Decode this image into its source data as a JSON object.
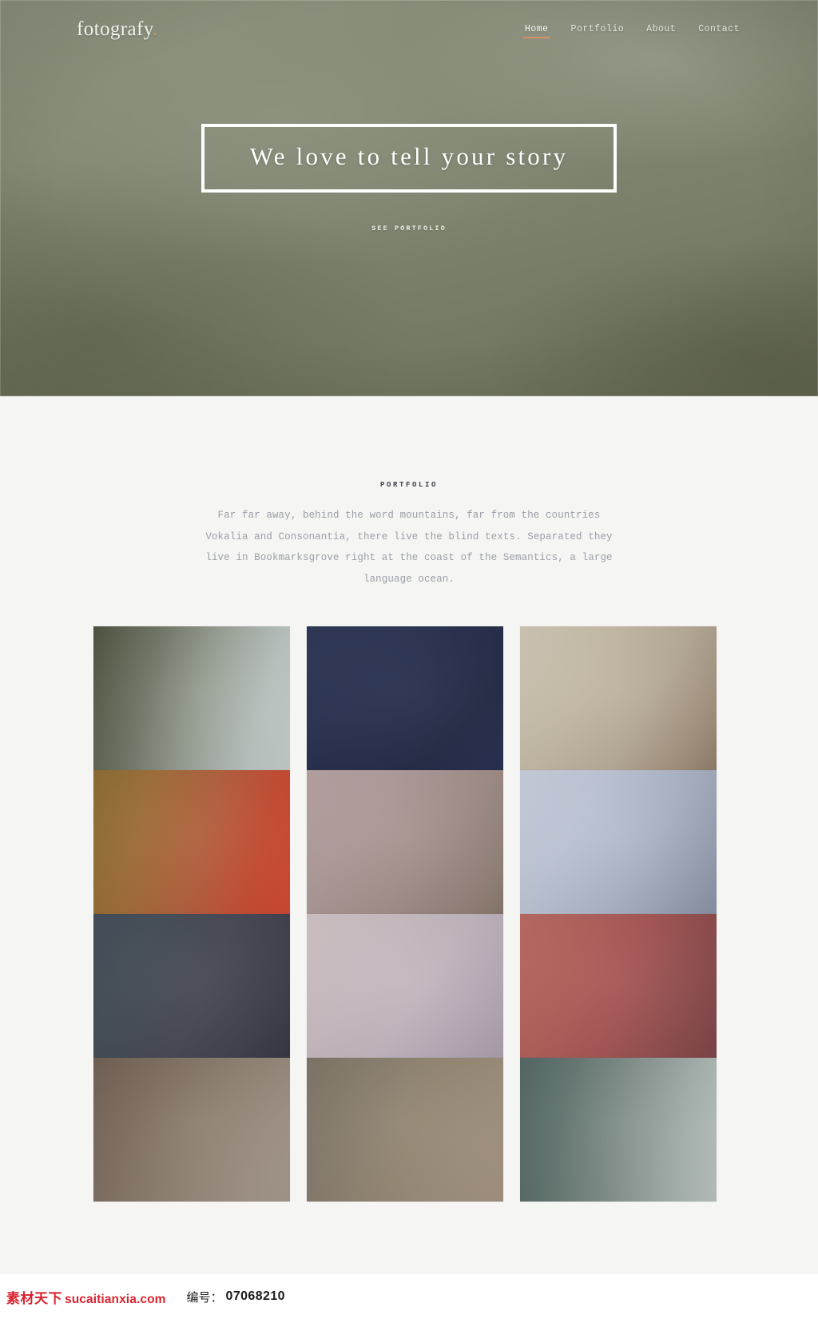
{
  "site": {
    "brand_text": "fotografy",
    "brand_dot": ".",
    "accent_color": "#d98f5f"
  },
  "nav": {
    "items": [
      {
        "label": "Home",
        "active": true
      },
      {
        "label": "Portfolio",
        "active": false
      },
      {
        "label": "About",
        "active": false
      },
      {
        "label": "Contact",
        "active": false
      }
    ]
  },
  "hero": {
    "headline": "We love to tell your story",
    "cta_label": "SEE PORTFOLIO",
    "background_colors": [
      "#8d9280",
      "#7e846f",
      "#6a7059"
    ]
  },
  "portfolio": {
    "heading": "PORTFOLIO",
    "description": "Far far away, behind the word mountains, far from the countries Vokalia and Consonantia, there live the blind texts. Separated they live in Bookmarksgrove right at the coast of the Semantics, a large language ocean.",
    "tiles": [
      {
        "name": "portfolio-image-1",
        "gradient": "linear-gradient(105deg, #4a4f3c 0%, #6c7261 28%, #9aa297 58%, #b9c2bf 82%, #c2cbc9 100%)"
      },
      {
        "name": "portfolio-image-2",
        "gradient": "linear-gradient(135deg, #2a3352 0%, #222b49 45%, #1d2541 75%, #232c4c 100%)"
      },
      {
        "name": "portfolio-image-3",
        "gradient": "linear-gradient(120deg, #cfc6b4 0%, #c2b7a3 35%, #b4a794 62%, #9e8b78 88%, #8e7a66 100%)"
      },
      {
        "name": "portfolio-image-4",
        "gradient": "linear-gradient(105deg, #8a6a2e 0%, #9c6a34 26%, #b05a38 55%, #c4472f 80%, #cf4330 100%)"
      },
      {
        "name": "portfolio-image-5",
        "gradient": "linear-gradient(125deg, #b5a0a0 0%, #ab9796 32%, #9d8a85 62%, #8e7d74 88%, #857467 100%)"
      },
      {
        "name": "portfolio-image-6",
        "gradient": "linear-gradient(120deg, #c7cddc 0%, #bcc3d3 30%, #a8b0c2 62%, #9199ab 88%, #868ea1 100%)"
      },
      {
        "name": "portfolio-image-7",
        "gradient": "linear-gradient(115deg, #3f4a55 0%, #404852 26%, #41434f 55%, #3b3b47 80%, #33333f 100%)"
      },
      {
        "name": "portfolio-image-8",
        "gradient": "linear-gradient(125deg, #cfc2c4 0%, #c7b9bf 30%, #bfb3bd 58%, #b2a6b3 82%, #a89ca9 100%)"
      },
      {
        "name": "portfolio-image-9",
        "gradient": "linear-gradient(110deg, #b9655e 0%, #ae5a55 28%, #a0504f 55%, #8a4748 80%, #7a4043 100%)"
      },
      {
        "name": "portfolio-image-10",
        "gradient": "linear-gradient(120deg, #6d5c50 0%, #7b6a5d 26%, #8d7d70 55%, #9c8d80 80%, #a3968a 100%)"
      },
      {
        "name": "portfolio-image-11",
        "gradient": "linear-gradient(115deg, #7b7262 0%, #857a6a 25%, #91836f 52%, #9b8c79 78%, #a1907e 100%)"
      },
      {
        "name": "portfolio-image-12",
        "gradient": "linear-gradient(100deg, #4f6461 0%, #61736e 25%, #7f8d88 52%, #a3aeaa 80%, #b8c1bd 100%)"
      }
    ]
  },
  "watermark": {
    "site_cn": "素材天下",
    "site_url": "sucaitianxia.com",
    "id_label": "编号：",
    "id_value": "07068210"
  }
}
